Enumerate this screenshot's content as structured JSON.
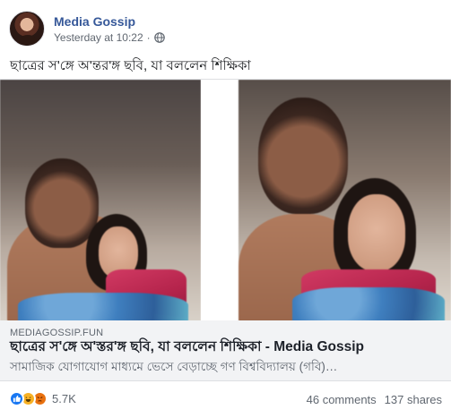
{
  "post": {
    "page_name": "Media Gossip",
    "timestamp": "Yesterday at 10:22",
    "separator": "·",
    "privacy_icon": "globe-icon",
    "text": "ছাত্রের স'ঙ্গে অ'ন্তর'ঙ্গ ছবি, যা বললেন শিক্ষিকা"
  },
  "link": {
    "domain": "MEDIAGOSSIP.FUN",
    "title": "ছাত্রের স'ঙ্গে অ'স্তর'ঙ্গ ছবি, যা বললেন শিক্ষিকা - Media Gossip",
    "description": "সামাজিক যোগাযোগ মাধ্যমে ভেসে বেড়াচ্ছে গণ বিশ্ববিদ্যালয় (গবি)…"
  },
  "reactions": {
    "icons": [
      "like-icon",
      "haha-icon",
      "angry-icon"
    ],
    "count": "5.7K"
  },
  "stats": {
    "comments": "46 comments",
    "shares": "137 shares"
  },
  "colors": {
    "link_blue": "#365899",
    "meta_gray": "#606770",
    "link_box_bg": "#f2f3f5",
    "like_blue": "#1877f2",
    "haha_yellow": "#f7b125",
    "angry_orange": "#e9710f"
  }
}
